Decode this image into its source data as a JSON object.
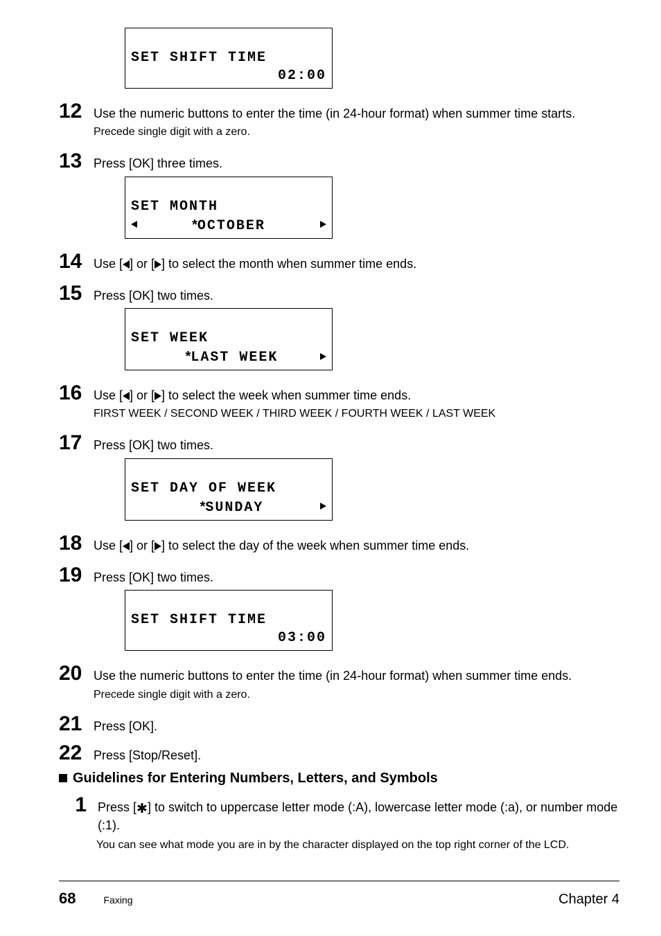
{
  "lcd1": {
    "line1": "SET SHIFT TIME",
    "time": "02:00"
  },
  "step12": {
    "num": "12",
    "body": "Use the numeric buttons to enter the time (in 24-hour format) when summer time starts.",
    "sub": "Precede single digit with a zero."
  },
  "step13": {
    "num": "13",
    "body": "Press [OK] three times."
  },
  "lcd2": {
    "line1": "SET MONTH",
    "value": "OCTOBER"
  },
  "step14": {
    "num": "14",
    "pre": "Use [",
    "mid": "] or [",
    "post": "] to select the month when summer time ends."
  },
  "step15": {
    "num": "15",
    "body": "Press [OK] two times."
  },
  "lcd3": {
    "line1": "SET WEEK",
    "value": "LAST WEEK"
  },
  "step16": {
    "num": "16",
    "pre": "Use [",
    "mid": "] or [",
    "post": "] to select the week when summer time ends.",
    "sub": "FIRST WEEK / SECOND WEEK / THIRD WEEK / FOURTH WEEK / LAST WEEK"
  },
  "step17": {
    "num": "17",
    "body": "Press [OK] two times."
  },
  "lcd4": {
    "line1": "SET DAY OF WEEK",
    "value": "SUNDAY"
  },
  "step18": {
    "num": "18",
    "pre": "Use [",
    "mid": "] or [",
    "post": "] to select the day of the week when summer time ends."
  },
  "step19": {
    "num": "19",
    "body": "Press [OK] two times."
  },
  "lcd5": {
    "line1": "SET SHIFT TIME",
    "time": "03:00"
  },
  "step20": {
    "num": "20",
    "body": "Use the numeric buttons to enter the time (in 24-hour format) when summer time ends.",
    "sub": "Precede single digit with a zero."
  },
  "step21": {
    "num": "21",
    "body": "Press [OK]."
  },
  "step22": {
    "num": "22",
    "body": "Press [Stop/Reset]."
  },
  "subhead": "Guidelines for Entering Numbers, Letters, and Symbols",
  "sub1": {
    "num": "1",
    "pre": "Press [",
    "star": "✱",
    "post": "] to switch to uppercase letter mode (:A), lowercase letter mode (:a), or number mode (:1).",
    "sub": "You can see what mode you are in by the character displayed on the top right corner of the LCD."
  },
  "footer": {
    "pagenum": "68",
    "section": "Faxing",
    "chapter": "Chapter 4"
  }
}
